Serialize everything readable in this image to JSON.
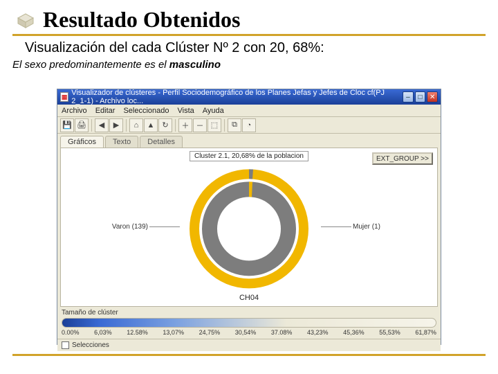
{
  "slide": {
    "title": "Resultado Obtenidos",
    "subtitle": "Visualización del cada Clúster Nº 2 con 20, 68%:",
    "subnote_prefix": "El sexo predominantemente es el ",
    "subnote_bold": "masculino"
  },
  "app": {
    "window_title": "Visualizador de clústeres - Perfil Sociodemográfico de los Planes Jefas y Jefes de Cloc cf(PJ 2_1-1) - Archivo loc...",
    "menus": [
      "Archivo",
      "Editar",
      "Seleccionado",
      "Vista",
      "Ayuda"
    ],
    "tabs": [
      "Gráficos",
      "Texto",
      "Detalles"
    ],
    "ext_button": "EXT_GROUP >>",
    "chart_title": "Cluster 2.1, 20,68% de la poblacion",
    "label_left": "Varon (139)",
    "label_right": "Mujer (1)",
    "axis_label": "CH04",
    "section_label": "Tamaño de clúster",
    "ticks": [
      "0.00%",
      "6,03%",
      "12.58%",
      "13,07%",
      "24,75%",
      "30,54%",
      "37.08%",
      "43,23%",
      "45,36%",
      "55,53%",
      "61,87%"
    ],
    "footer_checkbox_label": "Selecciones"
  },
  "chart_data": {
    "type": "pie",
    "title": "Cluster 2.1, 20,68% de la poblacion",
    "categories": [
      "Varon",
      "Mujer"
    ],
    "values": [
      139,
      1
    ],
    "colors": [
      "#7d7d7d",
      "#f1b700"
    ],
    "xlabel": "CH04",
    "inner_ring_colors": [
      "#7d7d7d",
      "#f1b700"
    ],
    "outer_ring_colors": [
      "#f1b700",
      "#7d7d7d"
    ]
  },
  "icons": {
    "cube": "cube-icon",
    "min": "–",
    "max": "□",
    "close": "✕"
  }
}
